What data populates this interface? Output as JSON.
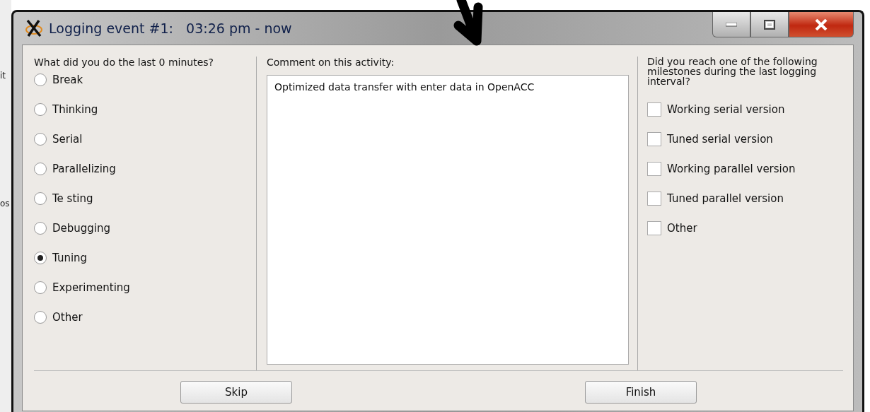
{
  "background": {
    "fragments": [
      "it",
      "os"
    ]
  },
  "window": {
    "title": "Logging event #1:   03:26 pm - now"
  },
  "activity": {
    "question": "What did you do the last 0 minutes?",
    "options": [
      {
        "label": "Break",
        "selected": false
      },
      {
        "label": "Thinking",
        "selected": false
      },
      {
        "label": "Serial",
        "selected": false
      },
      {
        "label": "Parallelizing",
        "selected": false
      },
      {
        "label": "Te sting",
        "selected": false
      },
      {
        "label": "Debugging",
        "selected": false
      },
      {
        "label": "Tuning",
        "selected": true
      },
      {
        "label": "Experimenting",
        "selected": false
      },
      {
        "label": "Other",
        "selected": false
      }
    ]
  },
  "comment": {
    "label": "Comment on this activity:",
    "value": "Optimized data transfer with enter data in OpenACC"
  },
  "milestones": {
    "question": "Did you reach one of the following milestones during the last logging interval?",
    "options": [
      {
        "label": "Working serial version",
        "checked": false
      },
      {
        "label": "Tuned serial version",
        "checked": false
      },
      {
        "label": "Working parallel version",
        "checked": false
      },
      {
        "label": "Tuned parallel version",
        "checked": false
      },
      {
        "label": "Other",
        "checked": false
      }
    ]
  },
  "buttons": [
    "Skip",
    "Finish"
  ]
}
